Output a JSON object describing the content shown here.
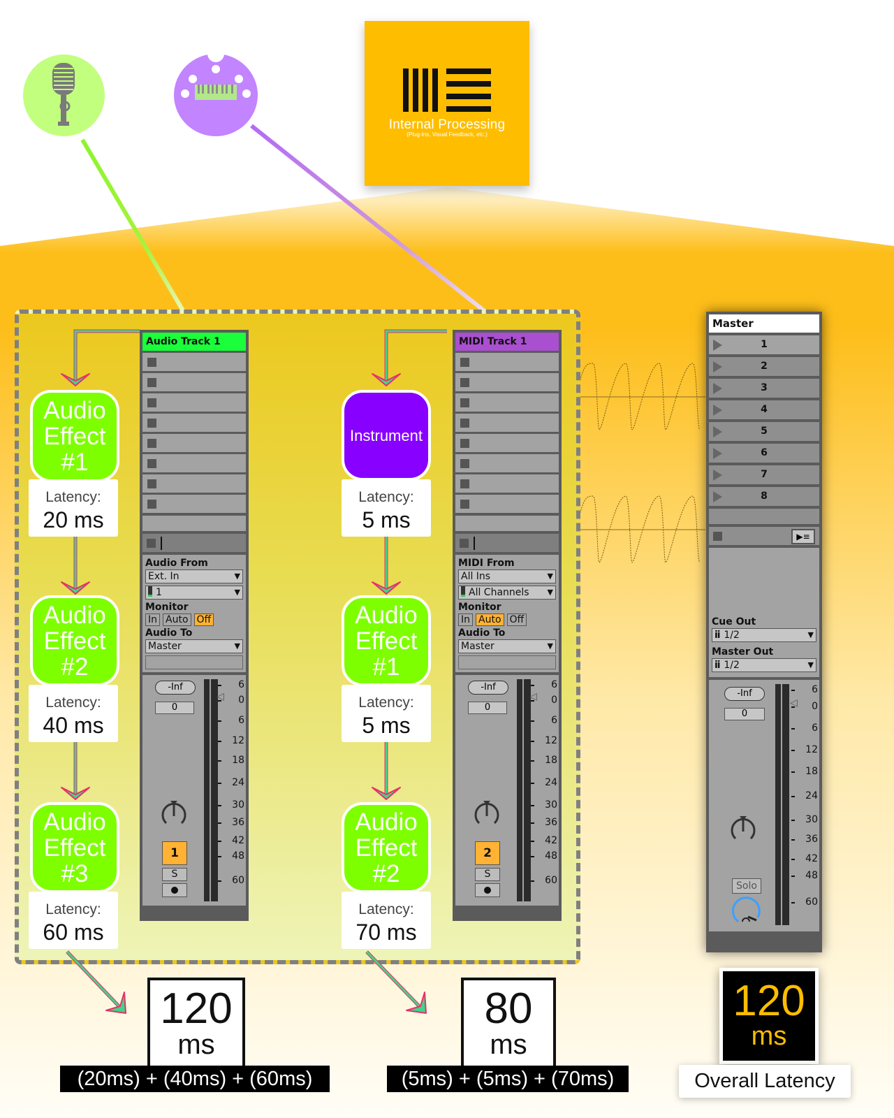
{
  "sources": {
    "audio_input_icon": "microphone-icon",
    "midi_input_icon": "midi-keyboard-icon",
    "internal": {
      "title": "Internal Processing",
      "subtitle": "(Plug-Ins, Visual Feedback, etc.)"
    }
  },
  "audio_chain": {
    "effects": [
      {
        "name": "Audio Effect #1",
        "lines": [
          "Audio",
          "Effect",
          "#1"
        ],
        "latency_label": "Latency:",
        "latency": "20 ms"
      },
      {
        "name": "Audio Effect #2",
        "lines": [
          "Audio",
          "Effect",
          "#2"
        ],
        "latency_label": "Latency:",
        "latency": "40 ms"
      },
      {
        "name": "Audio Effect #3",
        "lines": [
          "Audio",
          "Effect",
          "#3"
        ],
        "latency_label": "Latency:",
        "latency": "60 ms"
      }
    ],
    "total": {
      "value": "120",
      "unit": "ms",
      "formula": "(20ms) + (40ms) + (60ms)"
    }
  },
  "midi_chain": {
    "effects": [
      {
        "name": "Instrument",
        "lines": [
          "Instrument"
        ],
        "latency_label": "Latency:",
        "latency": "5 ms"
      },
      {
        "name": "Audio Effect #1",
        "lines": [
          "Audio",
          "Effect",
          "#1"
        ],
        "latency_label": "Latency:",
        "latency": "5 ms"
      },
      {
        "name": "Audio Effect #2",
        "lines": [
          "Audio",
          "Effect",
          "#2"
        ],
        "latency_label": "Latency:",
        "latency": "70 ms"
      }
    ],
    "total": {
      "value": "80",
      "unit": "ms",
      "formula": "(5ms) + (5ms) + (70ms)"
    }
  },
  "tracks": [
    {
      "title": "Audio Track 1",
      "color": "#1aff3a",
      "clip_slots": 8,
      "input_label": "Audio From",
      "input_type": "Ext. In",
      "input_channel": "1",
      "monitor_label": "Monitor",
      "monitor_options": [
        "In",
        "Auto",
        "Off"
      ],
      "monitor_active": "Off",
      "output_label": "Audio To",
      "output": "Master",
      "peak": "-Inf",
      "volume": "0",
      "track_number": "1",
      "solo": "S",
      "arm_icon": "record-arm-icon"
    },
    {
      "title": "MIDI Track 1",
      "color": "#a94fcf",
      "clip_slots": 8,
      "input_label": "MIDI From",
      "input_type": "All Ins",
      "input_channel": "All Channels",
      "monitor_label": "Monitor",
      "monitor_options": [
        "In",
        "Auto",
        "Off"
      ],
      "monitor_active": "Auto",
      "output_label": "Audio To",
      "output": "Master",
      "peak": "-Inf",
      "volume": "0",
      "track_number": "2",
      "solo": "S",
      "arm_icon": "record-arm-icon"
    }
  ],
  "meter_scale": [
    "6",
    "0",
    "6",
    "12",
    "18",
    "24",
    "30",
    "36",
    "42",
    "48",
    "60"
  ],
  "master": {
    "title": "Master",
    "scenes": [
      "1",
      "2",
      "3",
      "4",
      "5",
      "6",
      "7",
      "8"
    ],
    "cue_out_label": "Cue Out",
    "cue_out": "1/2",
    "master_out_label": "Master Out",
    "master_out": "1/2",
    "peak": "-Inf",
    "volume": "0",
    "solo": "Solo"
  },
  "overall": {
    "value": "120",
    "unit": "ms",
    "label": "Overall Latency"
  },
  "colors": {
    "accent_orange": "#ffbd00",
    "audio_green": "#7eff00",
    "instrument_purple": "#8800ff",
    "mic_green": "#c2ff7e",
    "midi_purple": "#c384ff"
  }
}
